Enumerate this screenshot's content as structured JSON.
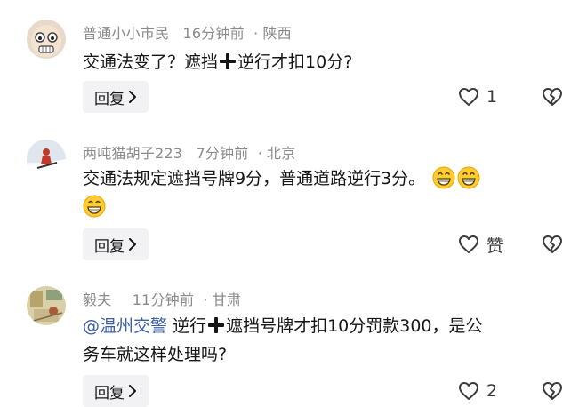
{
  "comments": [
    {
      "username": "普通小小市民",
      "time": "16分钟前",
      "location": "陕西",
      "text_parts": [
        "交通法变了？遮挡",
        "逆行才扣10分?"
      ],
      "reply_label": "回复",
      "like_count": "1",
      "avatar": "cartoon-face-avatar"
    },
    {
      "username": "两吨猫胡子223",
      "time": "7分钟前",
      "location": "北京",
      "text_line1": "交通法规定遮挡号牌9分，普通道路逆行3分。",
      "reply_label": "回复",
      "like_count": "赞",
      "avatar": "skier-avatar"
    },
    {
      "username": "毅夫",
      "time": "11分钟前",
      "location": "甘肃",
      "mention": "@温州交警",
      "text_parts": [
        "逆行",
        "遮挡号牌才扣10分罚款300，是公",
        "务车就这样处理吗?"
      ],
      "reply_label": "回复",
      "like_count": "2",
      "avatar": "painting-avatar"
    }
  ],
  "separator": "·",
  "icons": {
    "like": "heart-outline-icon",
    "dislike": "broken-heart-icon",
    "reply_arrow": "chevron-right-icon",
    "plus": "plus-icon",
    "emoji": "grinning-face-emoji"
  },
  "colors": {
    "meta_text": "#8a8a8e",
    "mention": "#3b5fa8",
    "reply_bg": "#f2f2f4"
  }
}
